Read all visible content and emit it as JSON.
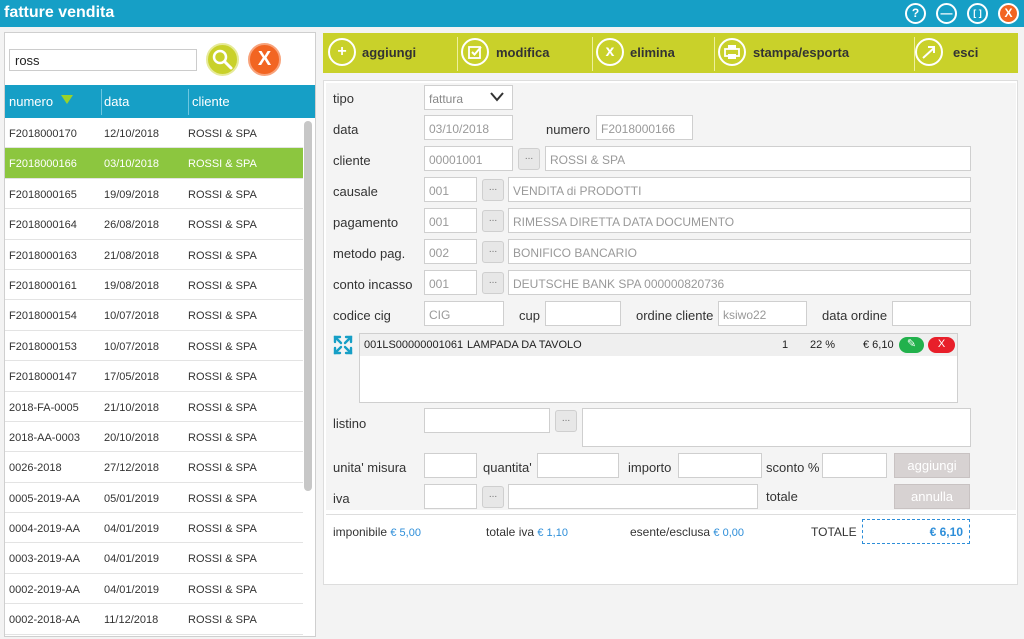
{
  "window": {
    "title": "fatture vendita",
    "controls": [
      "?",
      "—",
      "[ ]",
      "X"
    ]
  },
  "search": {
    "value": "ross"
  },
  "list": {
    "headers": {
      "numero": "numero",
      "data": "data",
      "cliente": "cliente"
    },
    "rows": [
      {
        "numero": "F2018000170",
        "data": "12/10/2018",
        "cliente": "ROSSI & SPA"
      },
      {
        "numero": "F2018000166",
        "data": "03/10/2018",
        "cliente": "ROSSI & SPA"
      },
      {
        "numero": "F2018000165",
        "data": "19/09/2018",
        "cliente": "ROSSI & SPA"
      },
      {
        "numero": "F2018000164",
        "data": "26/08/2018",
        "cliente": "ROSSI & SPA"
      },
      {
        "numero": "F2018000163",
        "data": "21/08/2018",
        "cliente": "ROSSI & SPA"
      },
      {
        "numero": "F2018000161",
        "data": "19/08/2018",
        "cliente": "ROSSI & SPA"
      },
      {
        "numero": "F2018000154",
        "data": "10/07/2018",
        "cliente": "ROSSI & SPA"
      },
      {
        "numero": "F2018000153",
        "data": "10/07/2018",
        "cliente": "ROSSI & SPA"
      },
      {
        "numero": "F2018000147",
        "data": "17/05/2018",
        "cliente": "ROSSI & SPA"
      },
      {
        "numero": "2018-FA-0005",
        "data": "21/10/2018",
        "cliente": "ROSSI & SPA"
      },
      {
        "numero": "2018-AA-0003",
        "data": "20/10/2018",
        "cliente": "ROSSI & SPA"
      },
      {
        "numero": "0026-2018",
        "data": "27/12/2018",
        "cliente": "ROSSI & SPA"
      },
      {
        "numero": "0005-2019-AA",
        "data": "05/01/2019",
        "cliente": "ROSSI & SPA"
      },
      {
        "numero": "0004-2019-AA",
        "data": "04/01/2019",
        "cliente": "ROSSI & SPA"
      },
      {
        "numero": "0003-2019-AA",
        "data": "04/01/2019",
        "cliente": "ROSSI & SPA"
      },
      {
        "numero": "0002-2019-AA",
        "data": "04/01/2019",
        "cliente": "ROSSI & SPA"
      },
      {
        "numero": "0002-2018-AA",
        "data": "11/12/2018",
        "cliente": "ROSSI & SPA"
      }
    ],
    "selected_index": 1
  },
  "toolbar": {
    "aggiungi": "aggiungi",
    "modifica": "modifica",
    "elimina": "elimina",
    "stampa": "stampa/esporta",
    "esci": "esci"
  },
  "form": {
    "tipo_label": "tipo",
    "tipo_value": "fattura",
    "data_label": "data",
    "data_value": "03/10/2018",
    "numero_label": "numero",
    "numero_value": "F2018000166",
    "cliente_label": "cliente",
    "cliente_code": "00001001",
    "cliente_name": "ROSSI  & SPA",
    "causale_label": "causale",
    "causale_code": "001",
    "causale_desc": "VENDITA di PRODOTTI",
    "pagamento_label": "pagamento",
    "pagamento_code": "001",
    "pagamento_desc": "RIMESSA DIRETTA DATA DOCUMENTO",
    "metodo_label": "metodo pag.",
    "metodo_code": "002",
    "metodo_desc": "BONIFICO BANCARIO",
    "conto_label": "conto incasso",
    "conto_code": "001",
    "conto_desc": "DEUTSCHE BANK SPA 000000820736",
    "cig_label": "codice cig",
    "cig_value": "CIG",
    "cup_label": "cup",
    "cup_value": "",
    "ordine_label": "ordine cliente",
    "ordine_value": "ksiwo22",
    "data_ordine_label": "data ordine",
    "data_ordine_value": "",
    "line": {
      "code": "001LS00000001061",
      "desc": "LAMPADA DA TAVOLO",
      "qty": "1",
      "iva": "22 %",
      "amount": "€ 6,10",
      "delete": "X"
    },
    "listino_label": "listino",
    "unita_label": "unita' misura",
    "quantita_label": "quantita'",
    "importo_label": "importo",
    "sconto_label": "sconto %",
    "iva_label": "iva",
    "totale_label": "totale",
    "aggiungi_btn": "aggiungi",
    "annulla_btn": "annulla"
  },
  "totals": {
    "imponibile_label": "imponibile",
    "imponibile": "€ 5,00",
    "totale_iva_label": "totale iva",
    "totale_iva": "€ 1,10",
    "esente_label": "esente/esclusa",
    "esente": "€ 0,00",
    "totale_label": "TOTALE",
    "totale": "€ 6,10"
  },
  "colors": {
    "header": "#169fc6",
    "accent": "#c9d12a",
    "selected_row": "#8cc63f",
    "close": "#f26522",
    "value_blue": "#2d8ed9"
  }
}
